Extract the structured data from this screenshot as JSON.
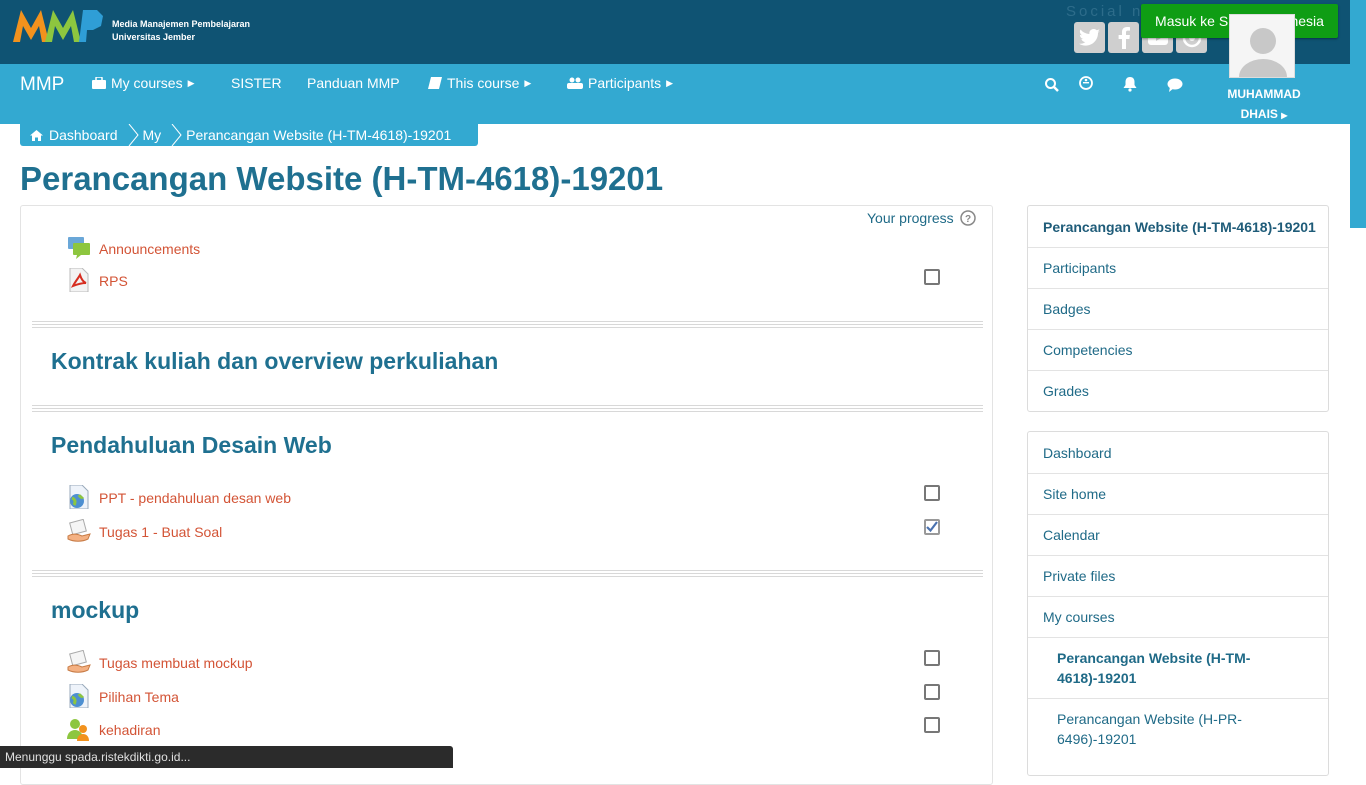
{
  "header": {
    "logo_text": "MMP",
    "org_line1": "Media Manajemen Pembelajaran",
    "org_line2": "Universitas Jember",
    "social_label": "Social n",
    "spada_button": "Masuk ke Spada Indonesia"
  },
  "nav": {
    "brand": "MMP",
    "my_courses": "My courses",
    "sister": "SISTER",
    "panduan": "Panduan MMP",
    "this_course": "This course",
    "participants": "Participants",
    "user_line1": "MUHAMMAD",
    "user_line2": "DHAIS"
  },
  "breadcrumb": {
    "dashboard": "Dashboard",
    "my": "My",
    "course": "Perancangan Website (H-TM-4618)-19201"
  },
  "page_title": "Perancangan Website (H-TM-4618)-19201",
  "progress_label": "Your progress",
  "sections": [
    {
      "title": "",
      "activities": [
        {
          "name": "Announcements",
          "icon": "forum-icon",
          "checkbox": null
        },
        {
          "name": "RPS",
          "icon": "pdf-icon",
          "checkbox": false
        }
      ]
    },
    {
      "title": "Kontrak kuliah dan overview perkuliahan",
      "activities": []
    },
    {
      "title": "Pendahuluan Desain Web",
      "activities": [
        {
          "name": "PPT - pendahuluan desan web",
          "icon": "url-icon",
          "checkbox": false
        },
        {
          "name": "Tugas 1 - Buat Soal",
          "icon": "assignment-icon",
          "checkbox": true
        }
      ]
    },
    {
      "title": "mockup",
      "activities": [
        {
          "name": "Tugas membuat mockup",
          "icon": "assignment-icon",
          "checkbox": false
        },
        {
          "name": "Pilihan Tema",
          "icon": "url-icon",
          "checkbox": false
        },
        {
          "name": "kehadiran",
          "icon": "attendance-icon",
          "checkbox": false
        }
      ]
    }
  ],
  "course_block": {
    "items": [
      "Perancangan Website (H-TM-4618)-19201",
      "Participants",
      "Badges",
      "Competencies",
      "Grades"
    ]
  },
  "nav_block": {
    "items": [
      "Dashboard",
      "Site home",
      "Calendar",
      "Private files",
      "My courses"
    ],
    "course_current": "Perancangan Website (H-TM-4618)-19201",
    "course_other": "Perancangan Website (H-PR-6496)-19201"
  },
  "status_bar": "Menunggu spada.ristekdikti.go.id...",
  "colors": {
    "topbar": "#0f5373",
    "navbar": "#33a9d1",
    "title": "#1f7090",
    "link": "#d35436",
    "spada": "#0f9d14"
  }
}
